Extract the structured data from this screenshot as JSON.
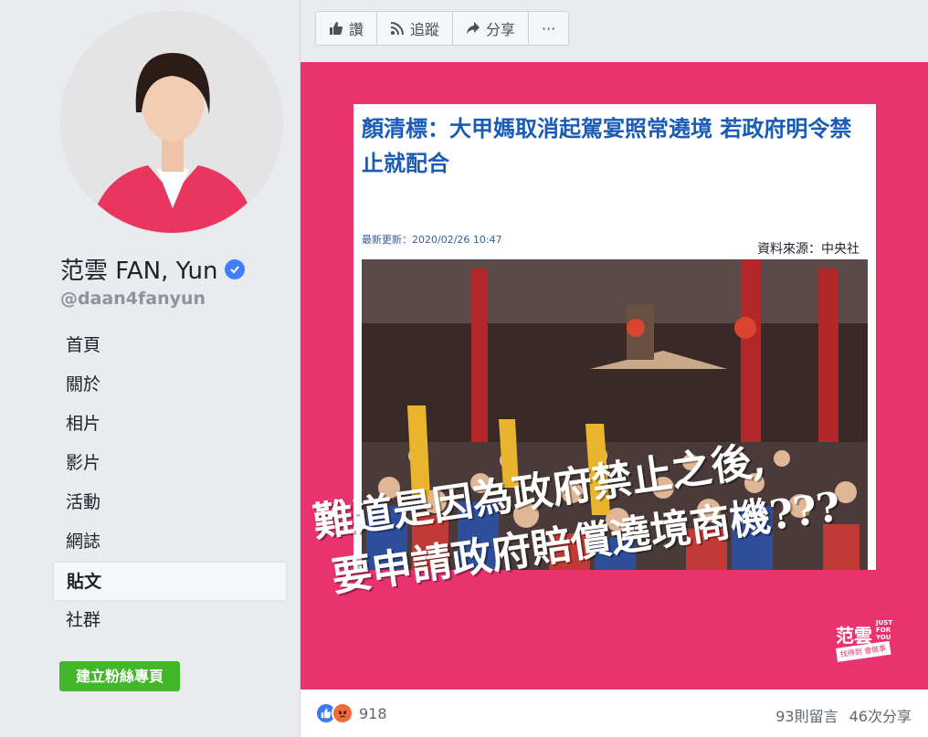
{
  "profile": {
    "name": "范雲 FAN, Yun",
    "handle": "@daan4fanyun"
  },
  "nav": {
    "items": [
      {
        "label": "首頁"
      },
      {
        "label": "關於"
      },
      {
        "label": "相片"
      },
      {
        "label": "影片"
      },
      {
        "label": "活動"
      },
      {
        "label": "網誌"
      },
      {
        "label": "貼文",
        "active": true
      },
      {
        "label": "社群"
      }
    ],
    "create_page": "建立粉絲專頁"
  },
  "toolbar": {
    "like": "讚",
    "follow": "追蹤",
    "share": "分享",
    "more": "···"
  },
  "post": {
    "article_title": "顏清標：大甲媽取消起駕宴照常遶境 若政府明令禁止就配合",
    "article_date": "最新更新：2020/02/26 10:47",
    "article_source": "資料來源：中央社",
    "overlay_line1": "難道是因為政府禁止之後,",
    "overlay_line2": "要申請政府賠償遶境商機???",
    "logo_main": "范雲",
    "logo_small": "JUST FOR YOU",
    "logo_tag": "找得到 會做事"
  },
  "footer": {
    "reaction_count": "918",
    "comments": "93則留言",
    "shares": "46次分享"
  },
  "colors": {
    "brand_pink": "#e8336f",
    "article_title_blue": "#1a5bb5",
    "create_button_green": "#42b72a",
    "verified_blue": "#4080ff"
  }
}
